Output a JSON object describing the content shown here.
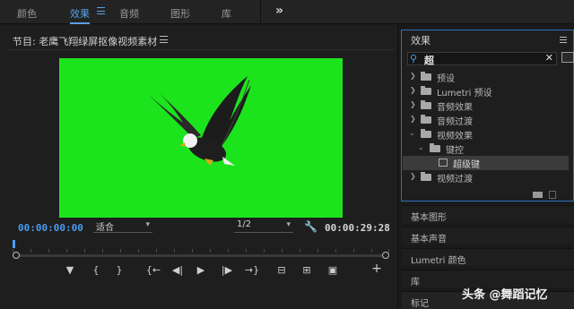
{
  "workspace": {
    "tabs": [
      {
        "label": "颜色"
      },
      {
        "label": "效果"
      },
      {
        "label": "音频"
      },
      {
        "label": "图形"
      },
      {
        "label": "库"
      }
    ],
    "more_label": "»"
  },
  "monitor": {
    "title": "节目: 老鹰飞翔绿屏抠像视频素材",
    "current_timecode": "00:00:00:00",
    "duration_timecode": "00:00:29:28",
    "zoom_select": "适合",
    "resolution_select": "1/2",
    "transport": {
      "add_marker": "▼",
      "mark_in": "{",
      "mark_out": "}",
      "go_to_in": "{←",
      "step_back": "◀|",
      "play": "▶",
      "step_forward": "|▶",
      "go_to_out": "→}",
      "insert": "⊟",
      "overwrite": "⊞",
      "export_frame": "▣",
      "add": "+"
    },
    "video_bg_color": "#1ce41c"
  },
  "effects_panel": {
    "title": "效果",
    "search_value": "超",
    "items": [
      {
        "label": "预设",
        "level": 0,
        "expanded": false,
        "kind": "folder"
      },
      {
        "label": "Lumetri 预设",
        "level": 0,
        "expanded": false,
        "kind": "folder"
      },
      {
        "label": "音频效果",
        "level": 0,
        "expanded": false,
        "kind": "folder"
      },
      {
        "label": "音频过渡",
        "level": 0,
        "expanded": false,
        "kind": "folder"
      },
      {
        "label": "视频效果",
        "level": 0,
        "expanded": true,
        "kind": "folder"
      },
      {
        "label": "键控",
        "level": 1,
        "expanded": true,
        "kind": "folder"
      },
      {
        "label": "超级键",
        "level": 2,
        "expanded": false,
        "kind": "effect",
        "selected": true
      },
      {
        "label": "视频过渡",
        "level": 0,
        "expanded": false,
        "kind": "folder"
      }
    ]
  },
  "side_panels": [
    {
      "label": "基本图形"
    },
    {
      "label": "基本声音"
    },
    {
      "label": "Lumetri 颜色"
    },
    {
      "label": "库"
    },
    {
      "label": "标记"
    }
  ],
  "watermark": "头条 @舞蹈记忆",
  "colors": {
    "accent": "#4b9cf0",
    "panel_border": "#2d6fc0"
  }
}
